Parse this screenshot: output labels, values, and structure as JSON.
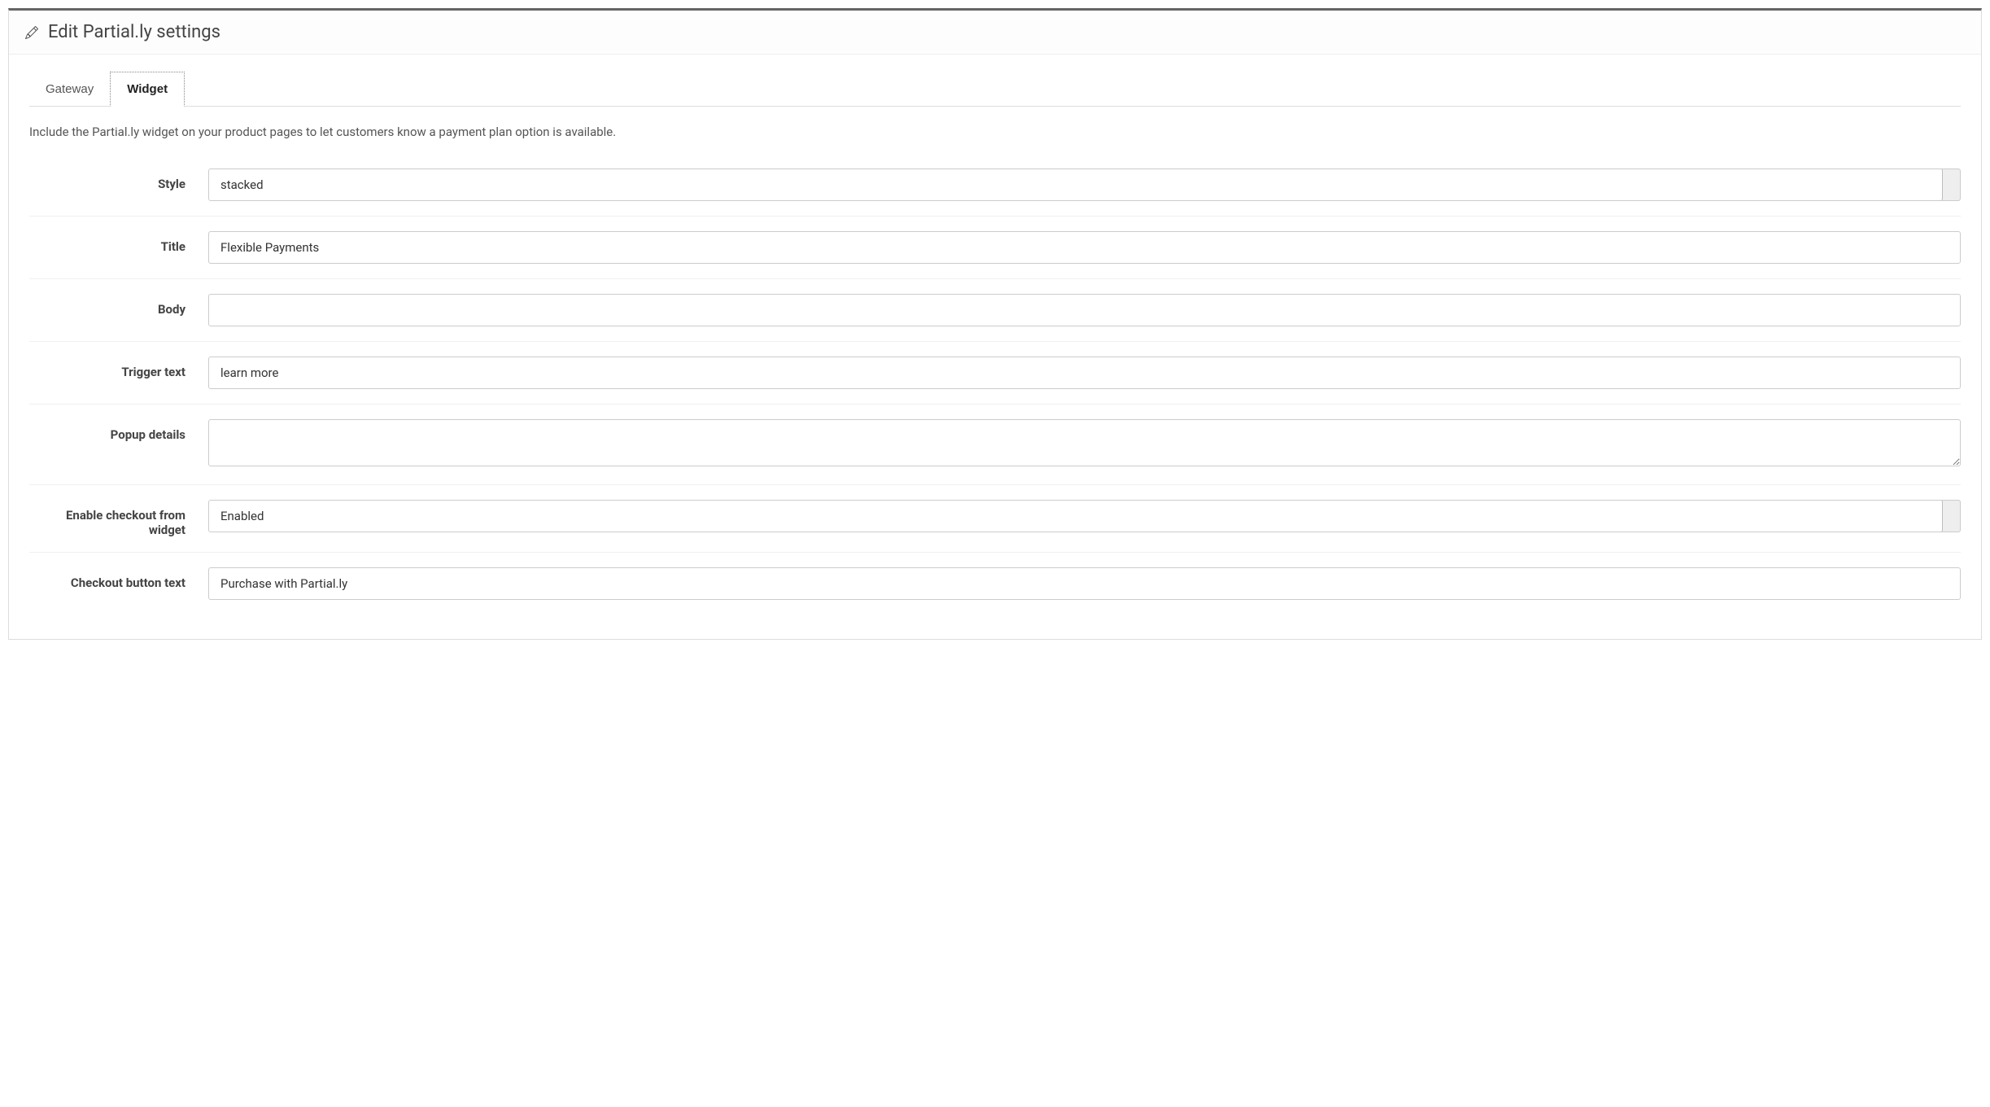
{
  "header": {
    "title": "Edit Partial.ly settings"
  },
  "tabs": {
    "gateway": "Gateway",
    "widget": "Widget"
  },
  "description": "Include the Partial.ly widget on your product pages to let customers know a payment plan option is available.",
  "form": {
    "style": {
      "label": "Style",
      "value": "stacked"
    },
    "title": {
      "label": "Title",
      "value": "Flexible Payments"
    },
    "body": {
      "label": "Body",
      "value": ""
    },
    "trigger_text": {
      "label": "Trigger text",
      "value": "learn more"
    },
    "popup_details": {
      "label": "Popup details",
      "value": ""
    },
    "enable_checkout": {
      "label": "Enable checkout from widget",
      "value": "Enabled"
    },
    "checkout_button_text": {
      "label": "Checkout button text",
      "value": "Purchase with Partial.ly"
    }
  }
}
